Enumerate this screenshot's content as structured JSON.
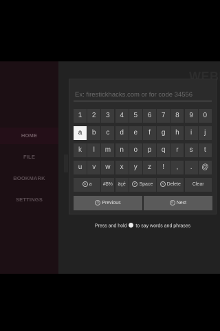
{
  "sidebar": {
    "items": [
      {
        "label": "HOME"
      },
      {
        "label": "FILE"
      },
      {
        "label": "BOOKMARK"
      },
      {
        "label": "SETTINGS"
      }
    ]
  },
  "background": {
    "title": "WEBLOADER C"
  },
  "keyboard": {
    "input_placeholder": "Ex: firestickhacks.com or for code 34556",
    "row1": [
      "1",
      "2",
      "3",
      "4",
      "5",
      "6",
      "7",
      "8",
      "9",
      "0"
    ],
    "row2": [
      "a",
      "b",
      "c",
      "d",
      "e",
      "f",
      "g",
      "h",
      "i",
      "j"
    ],
    "row3": [
      "k",
      "l",
      "m",
      "n",
      "o",
      "p",
      "q",
      "r",
      "s",
      "t"
    ],
    "row4": [
      "u",
      "v",
      "w",
      "x",
      "y",
      "z",
      "!",
      ",",
      ".",
      "@"
    ],
    "shift_label": "a",
    "shift_icon_text": "B",
    "symbols_label": "#$%",
    "accents_label": "äçé",
    "space_label": "Space",
    "space_icon_text": "P",
    "delete_label": "Delete",
    "delete_icon_text": "A",
    "clear_label": "Clear",
    "previous_label": "Previous",
    "previous_icon_text": "O",
    "next_label": "Next",
    "next_icon_text": "B"
  },
  "hint": {
    "before": "Press and hold",
    "after": "to say words and phrases"
  }
}
